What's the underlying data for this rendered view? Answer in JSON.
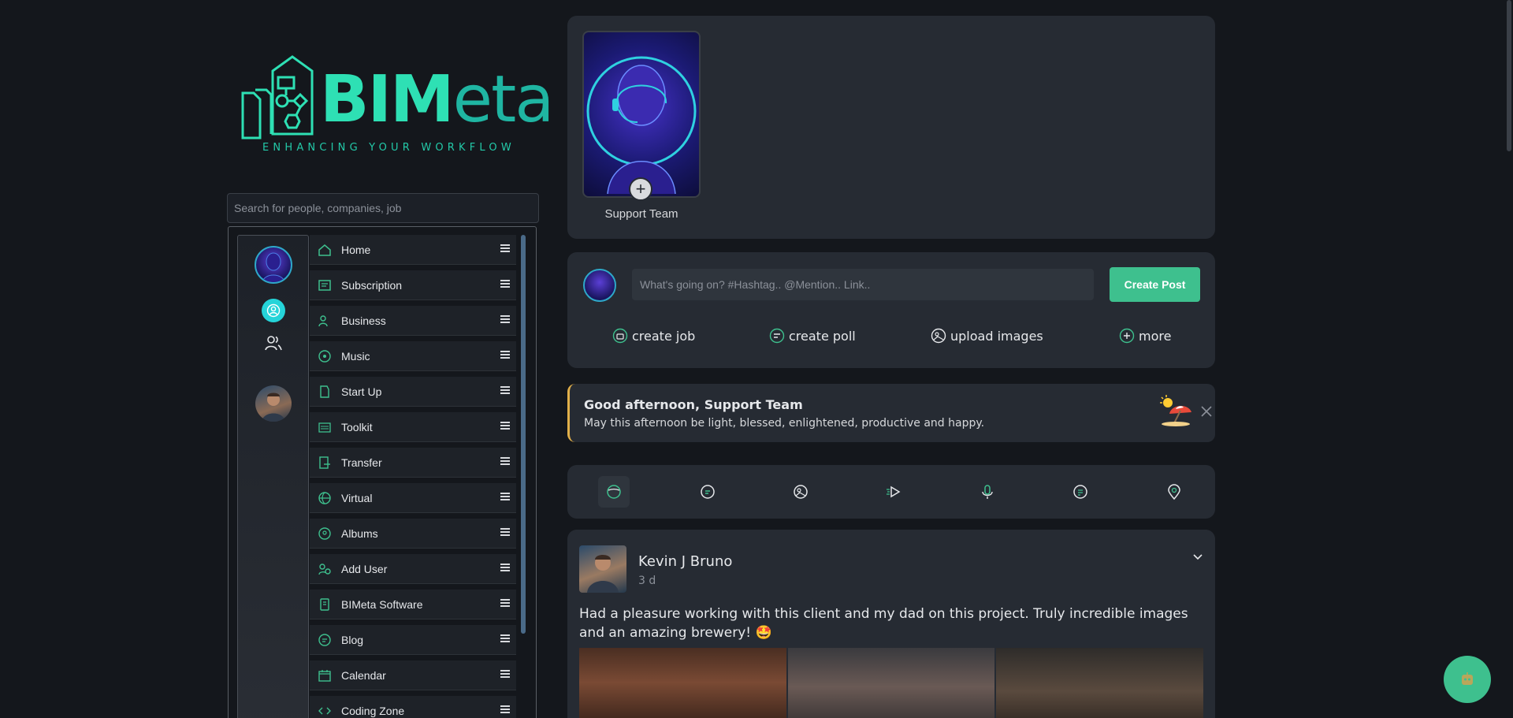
{
  "logo": {
    "name_bold": "BIM",
    "name_light": "eta",
    "tagline": "ENHANCING YOUR WORKFLOW"
  },
  "search": {
    "placeholder": "Search for people, companies, job"
  },
  "menu": [
    {
      "label": "Home",
      "icon": "home-icon"
    },
    {
      "label": "Subscription",
      "icon": "subscription-icon"
    },
    {
      "label": "Business",
      "icon": "business-icon"
    },
    {
      "label": "Music",
      "icon": "music-icon"
    },
    {
      "label": "Start Up",
      "icon": "startup-icon"
    },
    {
      "label": "Toolkit",
      "icon": "toolkit-icon"
    },
    {
      "label": "Transfer",
      "icon": "transfer-icon"
    },
    {
      "label": "Virtual",
      "icon": "globe-icon"
    },
    {
      "label": "Albums",
      "icon": "albums-icon"
    },
    {
      "label": "Add User",
      "icon": "add-user-icon"
    },
    {
      "label": "BIMeta Software",
      "icon": "software-icon"
    },
    {
      "label": "Blog",
      "icon": "blog-icon"
    },
    {
      "label": "Calendar",
      "icon": "calendar-icon"
    },
    {
      "label": "Coding Zone",
      "icon": "code-icon"
    }
  ],
  "story": {
    "name": "Support Team"
  },
  "compose": {
    "placeholder": "What's going on? #Hashtag.. @Mention.. Link..",
    "button": "Create Post",
    "actions": [
      "create job",
      "create poll",
      "upload images",
      "more"
    ]
  },
  "greeting": {
    "title": "Good afternoon, Support Team",
    "message": "May this afternoon be light, blessed, enlightened, productive and happy."
  },
  "post": {
    "author": "Kevin J Bruno",
    "time": "3 d",
    "text": "Had a pleasure working with this client and my dad on this project. Truly incredible images and an amazing brewery! 🤩"
  },
  "colors": {
    "accent": "#3ec08e",
    "teal": "#25d4d9",
    "card": "#262b33",
    "background": "#14171c",
    "greeting_border": "#e2b04a"
  }
}
